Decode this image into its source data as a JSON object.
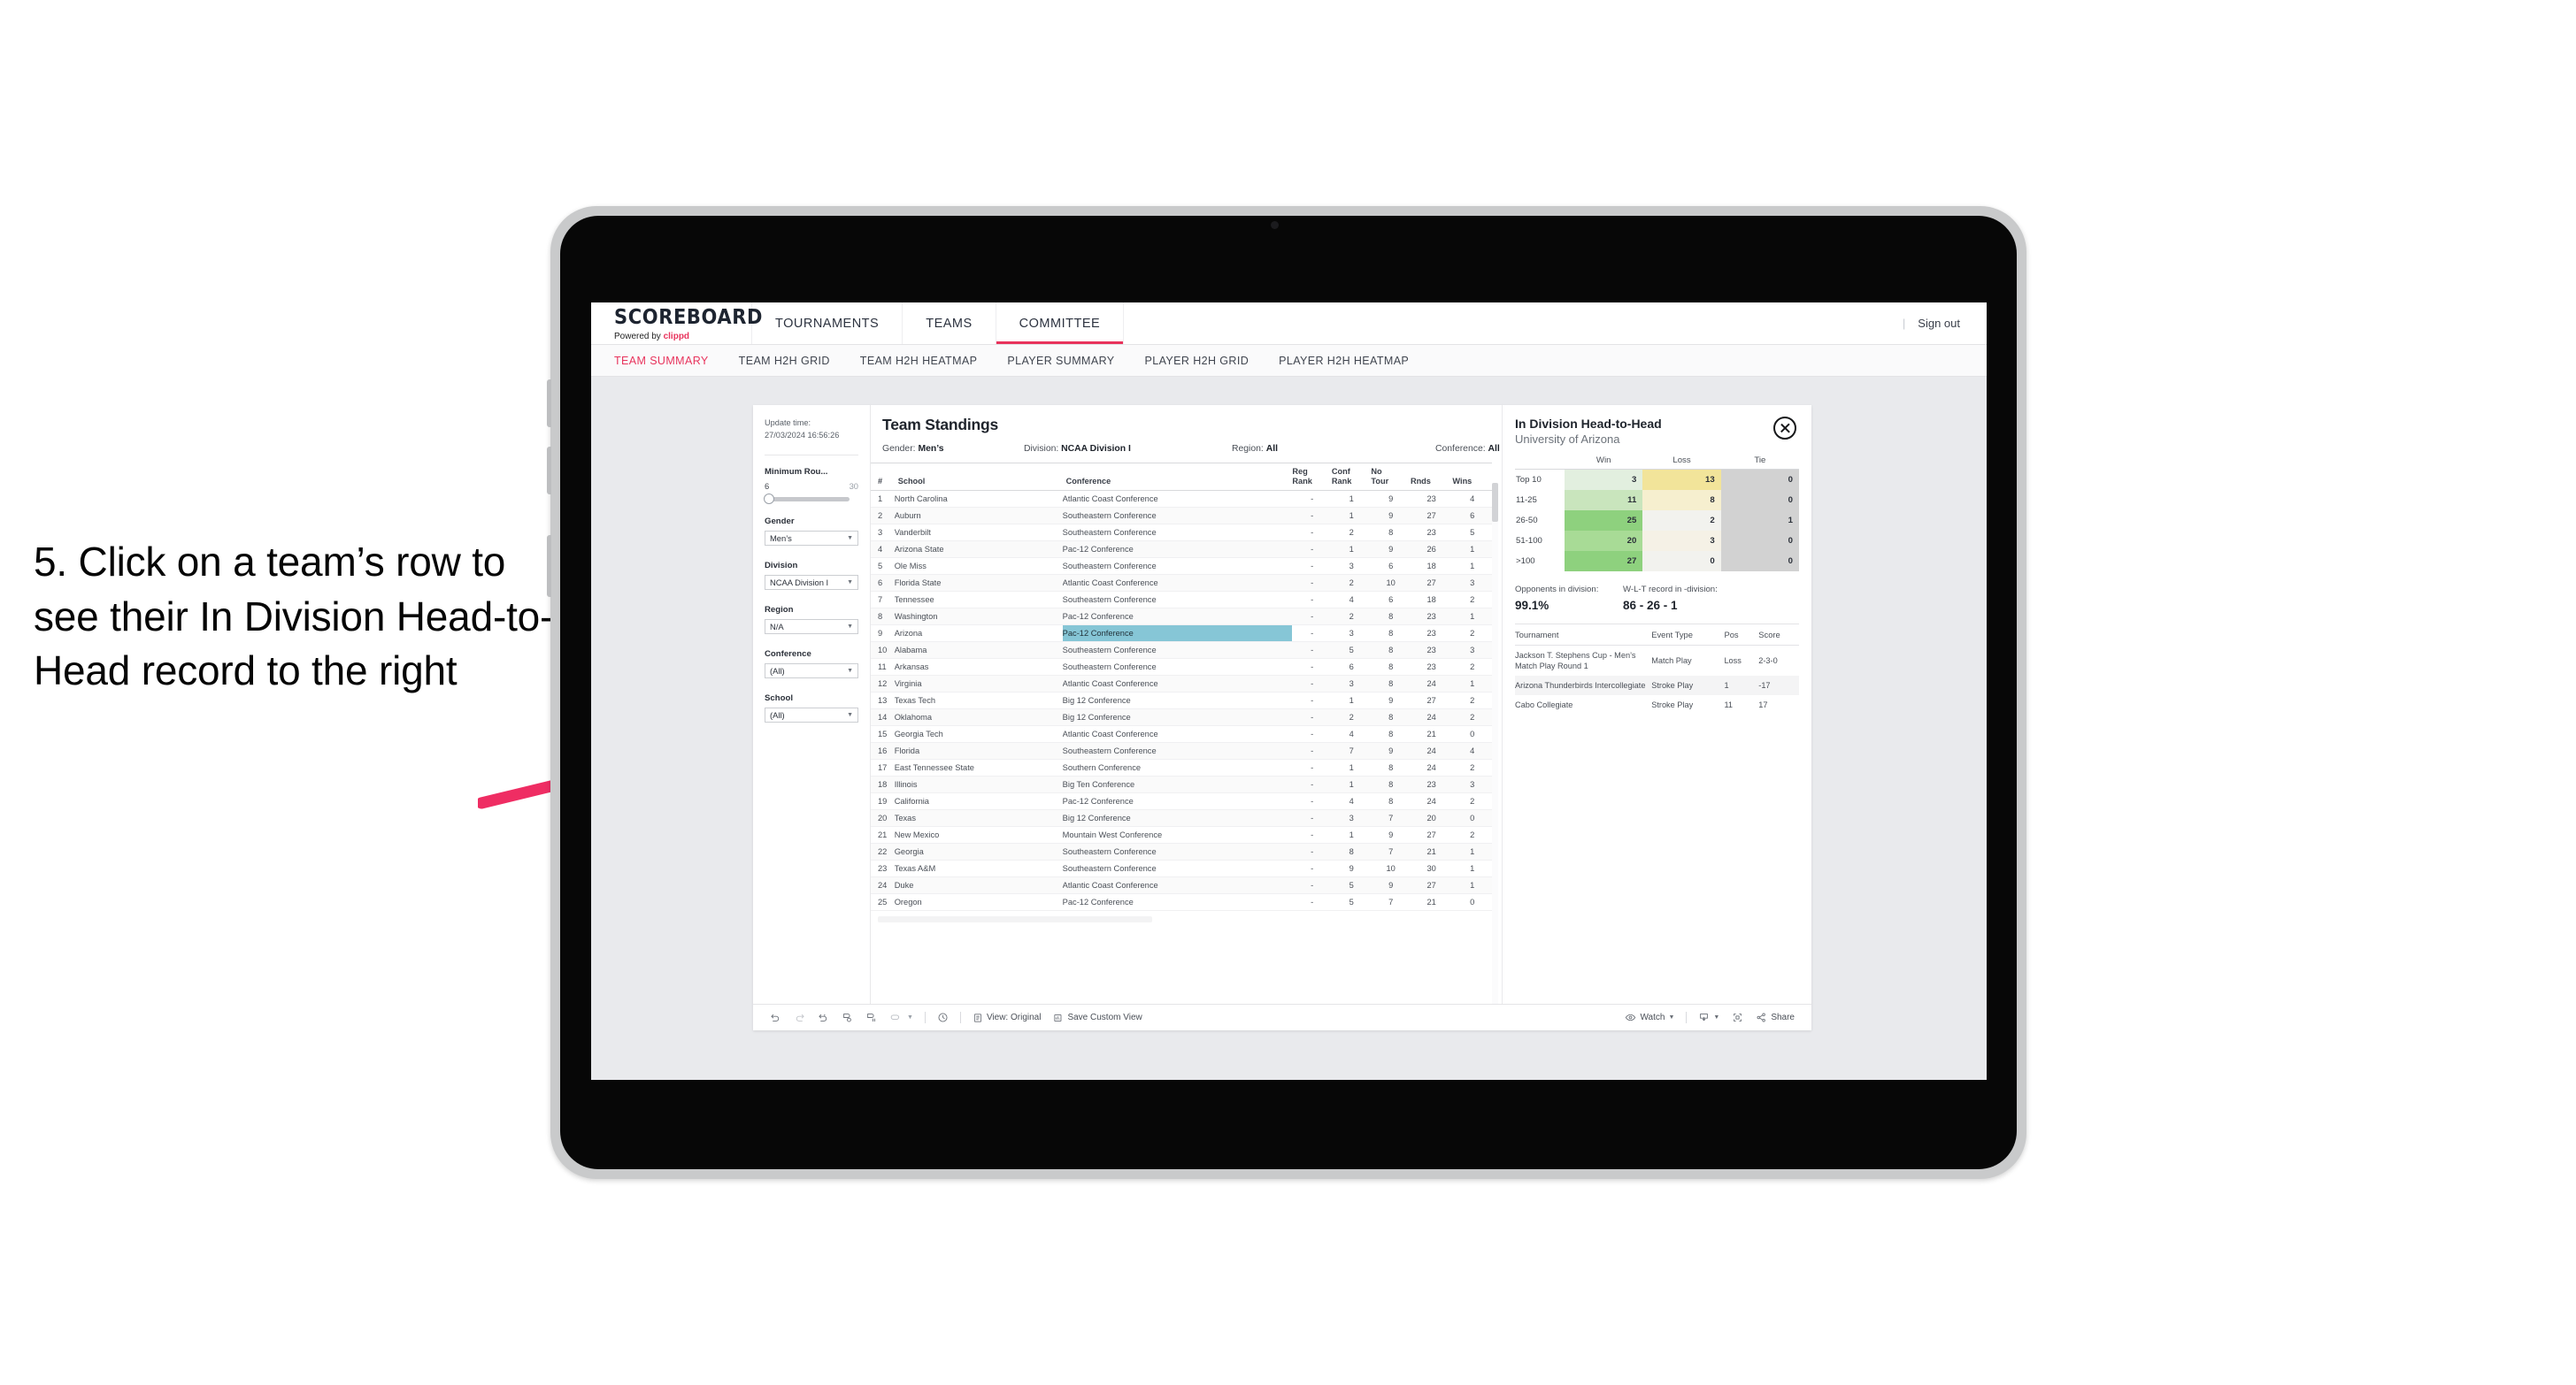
{
  "annotation": {
    "text": "5. Click on a team’s row to see their In Division Head-to-Head record to the right"
  },
  "app": {
    "brand": {
      "title": "SCOREBOARD",
      "powered_prefix": "Powered by ",
      "powered_brand": "clippd"
    },
    "nav": [
      {
        "label": "TOURNAMENTS",
        "active": false
      },
      {
        "label": "TEAMS",
        "active": false
      },
      {
        "label": "COMMITTEE",
        "active": true
      }
    ],
    "nav_right": {
      "separator": "|",
      "sign_out": "Sign out"
    },
    "subnav": [
      {
        "label": "TEAM SUMMARY",
        "active": true
      },
      {
        "label": "TEAM H2H GRID",
        "active": false
      },
      {
        "label": "TEAM H2H HEATMAP",
        "active": false
      },
      {
        "label": "PLAYER SUMMARY",
        "active": false
      },
      {
        "label": "PLAYER H2H GRID",
        "active": false
      },
      {
        "label": "PLAYER H2H HEATMAP",
        "active": false
      }
    ]
  },
  "filters": {
    "update_time_label": "Update time:",
    "update_time_value": "27/03/2024 16:56:26",
    "min_rounds": {
      "label": "Minimum Rou...",
      "min": "6",
      "max": "30"
    },
    "gender": {
      "label": "Gender",
      "value": "Men’s"
    },
    "division": {
      "label": "Division",
      "value": "NCAA Division I"
    },
    "region": {
      "label": "Region",
      "value": "N/A"
    },
    "conference": {
      "label": "Conference",
      "value": "(All)"
    },
    "school": {
      "label": "School",
      "value": "(All)"
    }
  },
  "standings": {
    "title": "Team Standings",
    "filter_line": [
      {
        "label": "Gender: ",
        "value": "Men’s"
      },
      {
        "label": "Division: ",
        "value": "NCAA Division I"
      },
      {
        "label": "Region: ",
        "value": "All"
      },
      {
        "label": "Conference: ",
        "value": "All"
      }
    ],
    "columns": [
      "#",
      "School",
      "Conference",
      "Reg Rank",
      "Conf Rank",
      "No Tour",
      "Rnds",
      "Wins"
    ],
    "rows": [
      {
        "n": "1",
        "school": "North Carolina",
        "conf": "Atlantic Coast Conference",
        "reg": "-",
        "cr": "1",
        "nt": "9",
        "rnds": "23",
        "wins": "4"
      },
      {
        "n": "2",
        "school": "Auburn",
        "conf": "Southeastern Conference",
        "reg": "-",
        "cr": "1",
        "nt": "9",
        "rnds": "27",
        "wins": "6"
      },
      {
        "n": "3",
        "school": "Vanderbilt",
        "conf": "Southeastern Conference",
        "reg": "-",
        "cr": "2",
        "nt": "8",
        "rnds": "23",
        "wins": "5"
      },
      {
        "n": "4",
        "school": "Arizona State",
        "conf": "Pac-12 Conference",
        "reg": "-",
        "cr": "1",
        "nt": "9",
        "rnds": "26",
        "wins": "1"
      },
      {
        "n": "5",
        "school": "Ole Miss",
        "conf": "Southeastern Conference",
        "reg": "-",
        "cr": "3",
        "nt": "6",
        "rnds": "18",
        "wins": "1"
      },
      {
        "n": "6",
        "school": "Florida State",
        "conf": "Atlantic Coast Conference",
        "reg": "-",
        "cr": "2",
        "nt": "10",
        "rnds": "27",
        "wins": "3"
      },
      {
        "n": "7",
        "school": "Tennessee",
        "conf": "Southeastern Conference",
        "reg": "-",
        "cr": "4",
        "nt": "6",
        "rnds": "18",
        "wins": "2"
      },
      {
        "n": "8",
        "school": "Washington",
        "conf": "Pac-12 Conference",
        "reg": "-",
        "cr": "2",
        "nt": "8",
        "rnds": "23",
        "wins": "1"
      },
      {
        "n": "9",
        "school": "Arizona",
        "conf": "Pac-12 Conference",
        "reg": "-",
        "cr": "3",
        "nt": "8",
        "rnds": "23",
        "wins": "2",
        "selected": true
      },
      {
        "n": "10",
        "school": "Alabama",
        "conf": "Southeastern Conference",
        "reg": "-",
        "cr": "5",
        "nt": "8",
        "rnds": "23",
        "wins": "3"
      },
      {
        "n": "11",
        "school": "Arkansas",
        "conf": "Southeastern Conference",
        "reg": "-",
        "cr": "6",
        "nt": "8",
        "rnds": "23",
        "wins": "2"
      },
      {
        "n": "12",
        "school": "Virginia",
        "conf": "Atlantic Coast Conference",
        "reg": "-",
        "cr": "3",
        "nt": "8",
        "rnds": "24",
        "wins": "1"
      },
      {
        "n": "13",
        "school": "Texas Tech",
        "conf": "Big 12 Conference",
        "reg": "-",
        "cr": "1",
        "nt": "9",
        "rnds": "27",
        "wins": "2"
      },
      {
        "n": "14",
        "school": "Oklahoma",
        "conf": "Big 12 Conference",
        "reg": "-",
        "cr": "2",
        "nt": "8",
        "rnds": "24",
        "wins": "2"
      },
      {
        "n": "15",
        "school": "Georgia Tech",
        "conf": "Atlantic Coast Conference",
        "reg": "-",
        "cr": "4",
        "nt": "8",
        "rnds": "21",
        "wins": "0"
      },
      {
        "n": "16",
        "school": "Florida",
        "conf": "Southeastern Conference",
        "reg": "-",
        "cr": "7",
        "nt": "9",
        "rnds": "24",
        "wins": "4"
      },
      {
        "n": "17",
        "school": "East Tennessee State",
        "conf": "Southern Conference",
        "reg": "-",
        "cr": "1",
        "nt": "8",
        "rnds": "24",
        "wins": "2"
      },
      {
        "n": "18",
        "school": "Illinois",
        "conf": "Big Ten Conference",
        "reg": "-",
        "cr": "1",
        "nt": "8",
        "rnds": "23",
        "wins": "3"
      },
      {
        "n": "19",
        "school": "California",
        "conf": "Pac-12 Conference",
        "reg": "-",
        "cr": "4",
        "nt": "8",
        "rnds": "24",
        "wins": "2"
      },
      {
        "n": "20",
        "school": "Texas",
        "conf": "Big 12 Conference",
        "reg": "-",
        "cr": "3",
        "nt": "7",
        "rnds": "20",
        "wins": "0"
      },
      {
        "n": "21",
        "school": "New Mexico",
        "conf": "Mountain West Conference",
        "reg": "-",
        "cr": "1",
        "nt": "9",
        "rnds": "27",
        "wins": "2"
      },
      {
        "n": "22",
        "school": "Georgia",
        "conf": "Southeastern Conference",
        "reg": "-",
        "cr": "8",
        "nt": "7",
        "rnds": "21",
        "wins": "1"
      },
      {
        "n": "23",
        "school": "Texas A&M",
        "conf": "Southeastern Conference",
        "reg": "-",
        "cr": "9",
        "nt": "10",
        "rnds": "30",
        "wins": "1"
      },
      {
        "n": "24",
        "school": "Duke",
        "conf": "Atlantic Coast Conference",
        "reg": "-",
        "cr": "5",
        "nt": "9",
        "rnds": "27",
        "wins": "1"
      },
      {
        "n": "25",
        "school": "Oregon",
        "conf": "Pac-12 Conference",
        "reg": "-",
        "cr": "5",
        "nt": "7",
        "rnds": "21",
        "wins": "0"
      }
    ]
  },
  "h2h": {
    "title": "In Division Head-to-Head",
    "subtitle": "University of Arizona",
    "close_icon": "close-icon",
    "columns": [
      "",
      "Win",
      "Loss",
      "Tie"
    ],
    "rows": [
      {
        "band": "Top 10",
        "win": "3",
        "loss": "13",
        "tie": "0",
        "win_color": "#e2efdf",
        "loss_color": "#f2e49a",
        "tie_color": "#d2d2d2"
      },
      {
        "band": "11-25",
        "win": "11",
        "loss": "8",
        "tie": "0",
        "win_color": "#c9e5bd",
        "loss_color": "#f6efcf",
        "tie_color": "#d2d2d2"
      },
      {
        "band": "26-50",
        "win": "25",
        "loss": "2",
        "tie": "1",
        "win_color": "#8ed17e",
        "loss_color": "#f2f2ee",
        "tie_color": "#d2d2d2"
      },
      {
        "band": "51-100",
        "win": "20",
        "loss": "3",
        "tie": "0",
        "win_color": "#a8db96",
        "loss_color": "#f5f1e6",
        "tie_color": "#d2d2d2"
      },
      {
        "band": ">100",
        "win": "27",
        "loss": "0",
        "tie": "0",
        "win_color": "#8ed17e",
        "loss_color": "#f2f2ee",
        "tie_color": "#d2d2d2"
      }
    ],
    "stats": {
      "opponents_label": "Opponents in division:",
      "opponents_value": "99.1%",
      "record_label": "W-L-T record in -division:",
      "record_value": "86 - 26 - 1"
    },
    "tournament_columns": [
      "Tournament",
      "Event Type",
      "Pos",
      "Score"
    ],
    "tournaments": [
      {
        "name": "Jackson T. Stephens Cup - Men’s Match Play Round 1",
        "type": "Match Play",
        "pos": "Loss",
        "score": "2-3-0"
      },
      {
        "name": "Arizona Thunderbirds Intercollegiate",
        "type": "Stroke Play",
        "pos": "1",
        "score": "-17",
        "shade": true
      },
      {
        "name": "Cabo Collegiate",
        "type": "Stroke Play",
        "pos": "11",
        "score": "17"
      }
    ]
  },
  "toolbar": {
    "undo": "undo-icon",
    "redo": "redo-icon",
    "revert": "revert-icon",
    "refresh": "refresh-icon",
    "pause": "pause-icon",
    "region": "region-icon",
    "clock": "clock-icon",
    "view_label": "View: Original",
    "save_view_label": "Save Custom View",
    "watch_label": "Watch",
    "download": "download-icon",
    "fullscreen": "fullscreen-icon",
    "share_label": "Share"
  },
  "colors": {
    "accent": "#e8335c",
    "selected_row": "#86c6d6",
    "screen_bg": "#e9eaed"
  }
}
